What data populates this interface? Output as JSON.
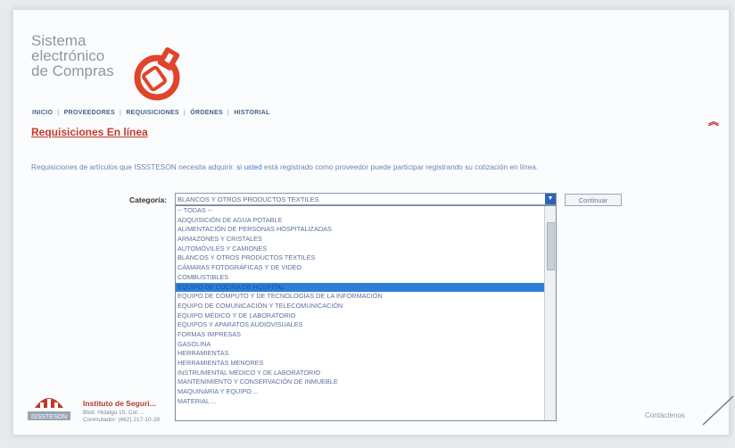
{
  "logo": {
    "line1": "Sistema",
    "line2": "electrónico",
    "line3": "de Compras"
  },
  "nav": {
    "items": [
      "INICIO",
      "PROVEEDORES",
      "REQUISICIONES",
      "ÓRDENES",
      "HISTORIAL"
    ]
  },
  "page_title": "Requisiciones En línea",
  "intro": {
    "text_before": "Requisiciones de artículos que ISSSTESON necesita adquirir. ",
    "link_text": "si usted",
    "text_after": " está registrado como proveedor puede participar registrando su cotización en línea."
  },
  "category": {
    "label": "Categoría:",
    "selected": "BLANCOS Y OTROS PRODUCTOS TEXTILES",
    "button": "Continuar",
    "options": [
      "-- TODAS --",
      "ADQUISICIÓN DE AGUA POTABLE",
      "ALIMENTACIÓN DE PERSONAS HOSPITALIZADAS",
      "ARMAZONES Y CRISTALES",
      "AUTOMÓVILES Y CAMIONES",
      "BLANCOS Y OTROS PRODUCTOS TEXTILES",
      "CÁMARAS FOTOGRÁFICAS Y DE VIDEO",
      "COMBUSTIBLES",
      "EQUIPO DE COCINA DE HOSPITAL",
      "EQUIPO DE CÓMPUTO Y DE TECNOLOGÍAS DE LA INFORMACIÓN",
      "EQUIPO DE COMUNICACIÓN Y TELECOMUNICACIÓN",
      "EQUIPO MÉDICO Y DE LABORATORIO",
      "EQUIPOS Y APARATOS AUDIOVISUALES",
      "FORMAS IMPRESAS",
      "GASOLINA",
      "HERRAMIENTAS",
      "HERRAMIENTAS MENORES",
      "INSTRUMENTAL MÉDICO Y DE LABORATORIO",
      "MANTENIMIENTO Y CONSERVACIÓN DE INMUEBLE",
      "MAQUINARIA Y EQUIPO ...",
      "MATERIAL ..."
    ],
    "highlighted_index": 8
  },
  "footer": {
    "org": "Instituto de Seguri...",
    "addr1": "Blvd. Hidalgo 15, Col. ...",
    "addr2": "Conmutador: (662) 217-10-28",
    "abbrev": "ISSSTESON",
    "contact": "Contáctenos"
  },
  "colors": {
    "accent": "#c53a2c",
    "link": "#3a7bd5",
    "highlight": "#2f7fd8"
  }
}
